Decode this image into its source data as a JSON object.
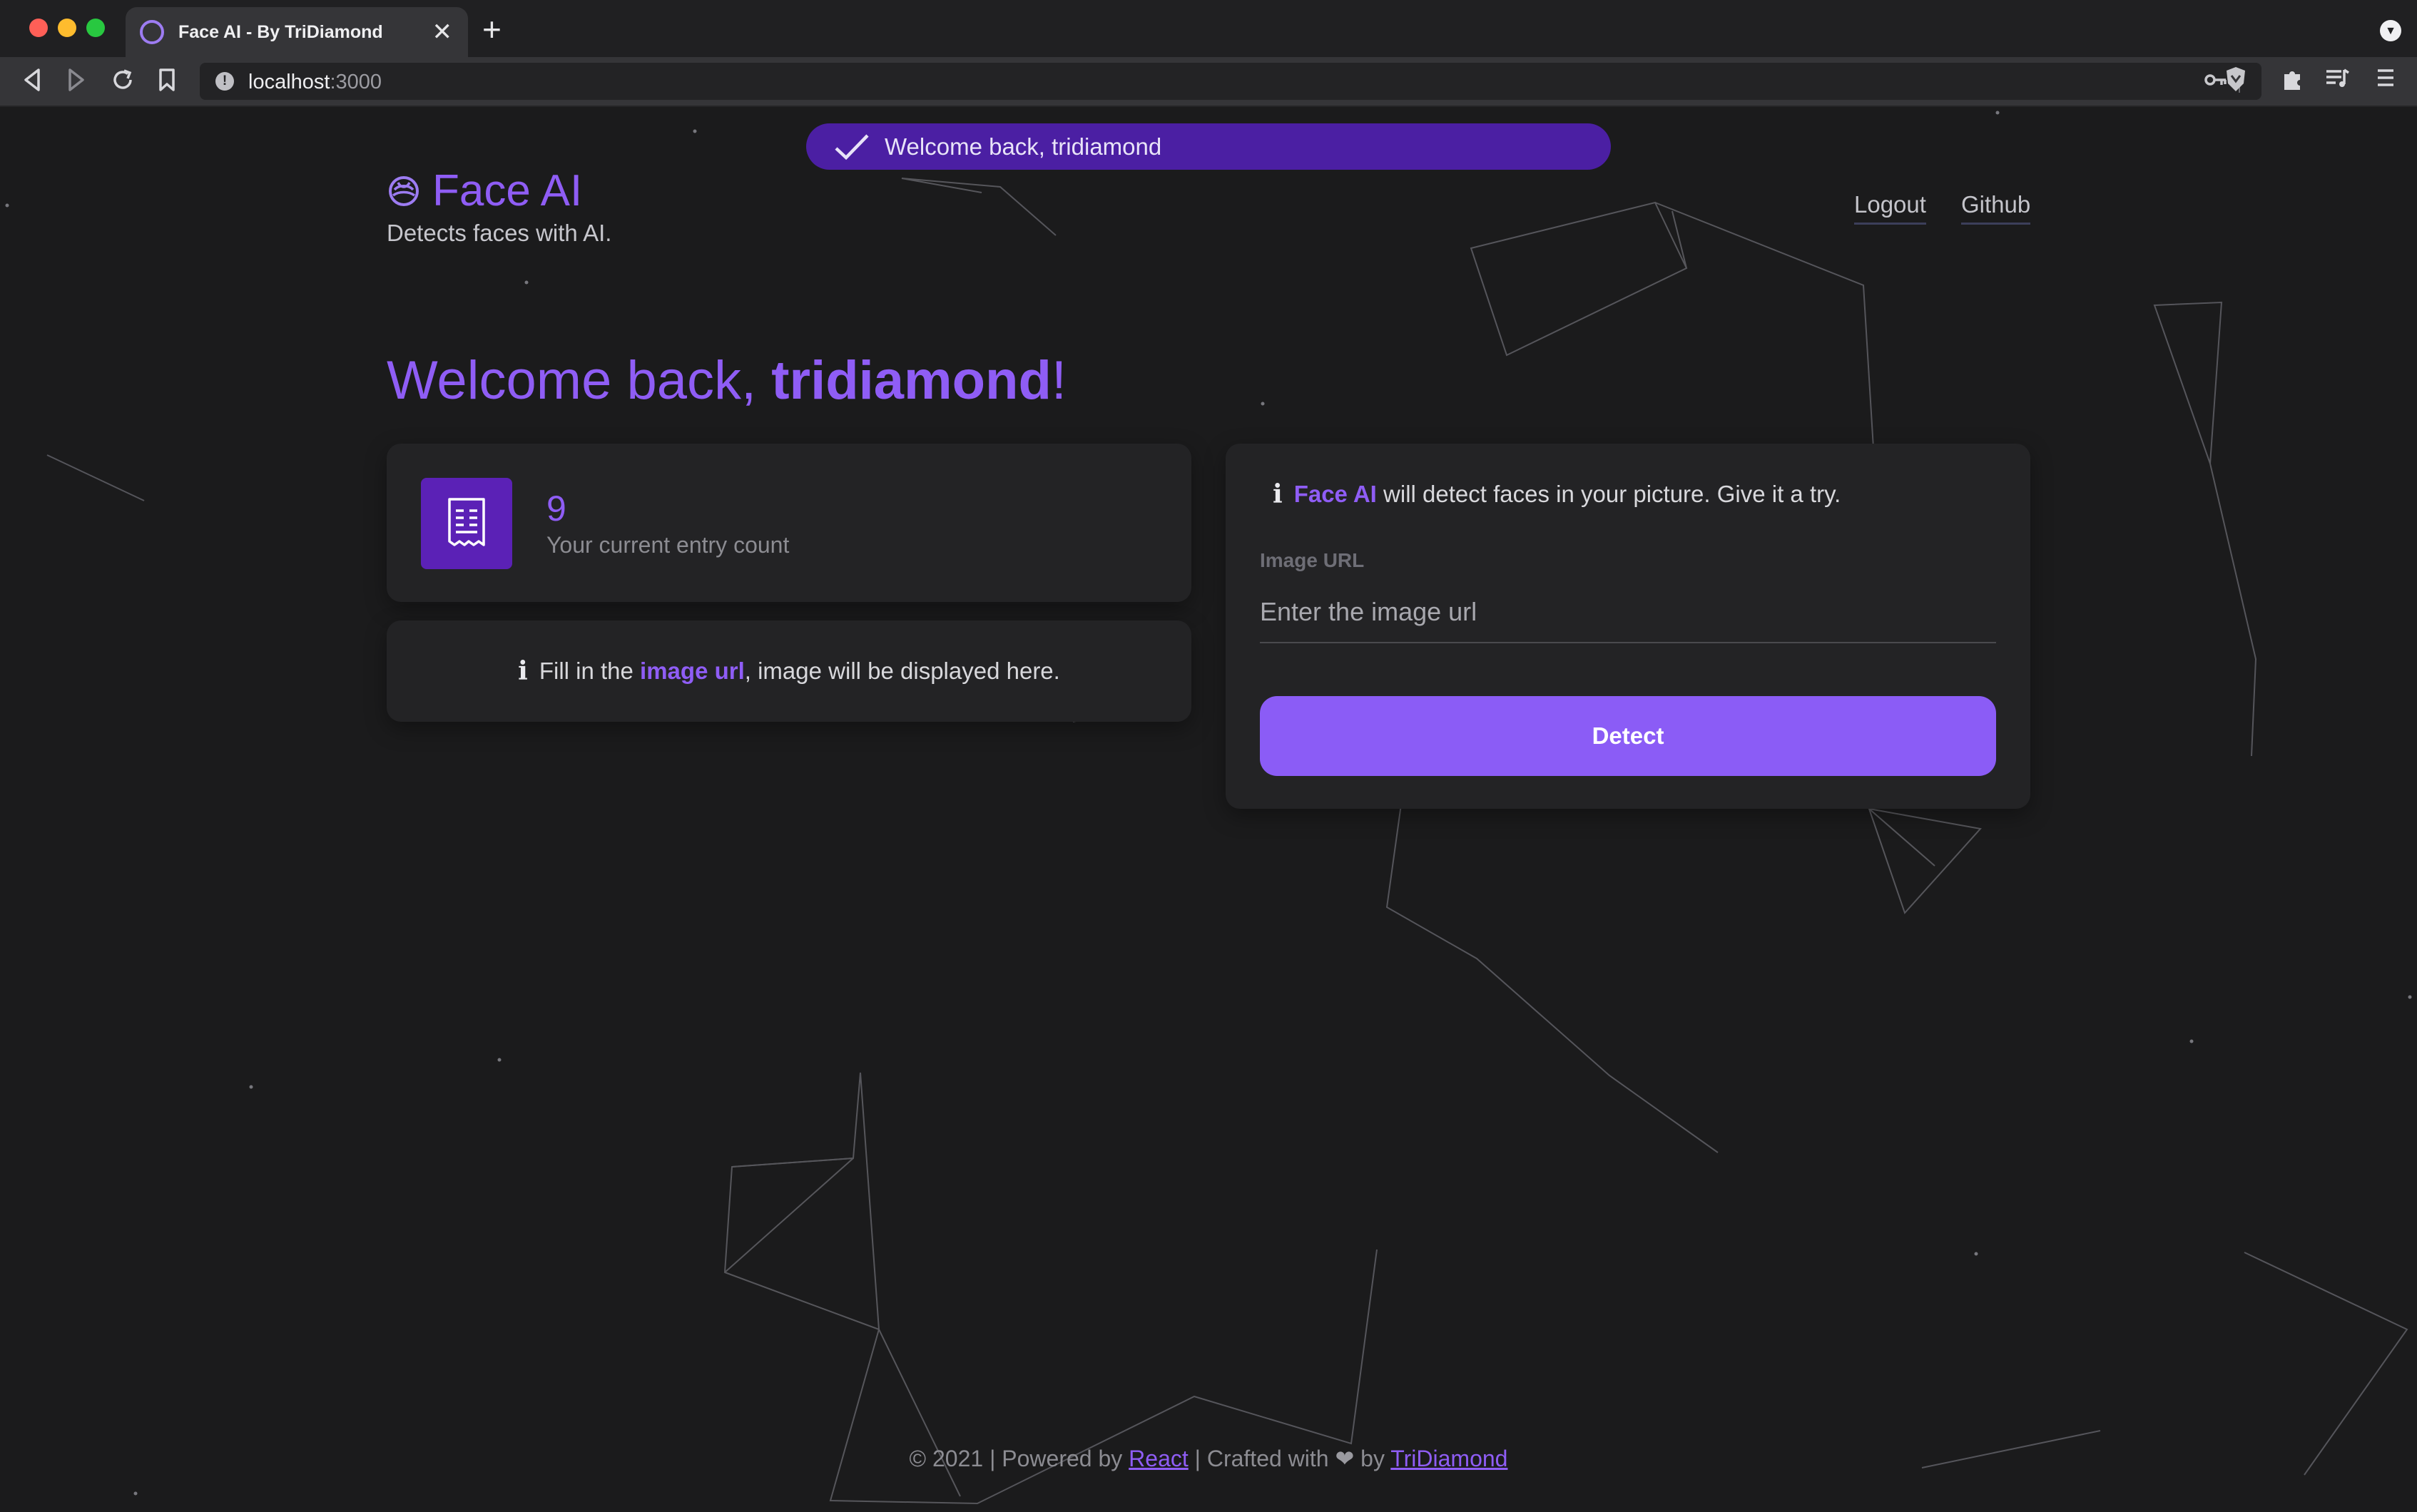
{
  "browser": {
    "tab_title": "Face AI - By TriDiamond",
    "tab_close": "✕",
    "new_tab": "+",
    "url_host": "localhost",
    "url_port": ":3000"
  },
  "toast": {
    "message": "Welcome back, tridiamond"
  },
  "header": {
    "app_name": "Face AI",
    "tagline": "Detects faces with AI.",
    "nav": {
      "logout": "Logout",
      "github": "Github"
    }
  },
  "welcome": {
    "prefix": "Welcome back, ",
    "username": "tridiamond",
    "suffix": "!"
  },
  "entry": {
    "count": "9",
    "label": "Your current entry count"
  },
  "image_panel": {
    "info_glyph": "i",
    "text_before": "Fill in the ",
    "highlight": "image url",
    "text_after": ", image will be displayed here."
  },
  "form": {
    "info_glyph": "i",
    "info_highlight": "Face AI",
    "info_text": " will detect faces in your picture. Give it a try.",
    "field_label": "Image URL",
    "input_value": "",
    "input_placeholder": "Enter the image url",
    "submit_label": "Detect"
  },
  "footer": {
    "prefix": "© 2021 | Powered by ",
    "react_link": "React",
    "middle": " | Crafted with ",
    "heart": "❤",
    "by": " by ",
    "author_link": "TriDiamond"
  },
  "colors": {
    "accent": "#8f5df5",
    "background": "#1b1b1c",
    "card": "#232325",
    "toast": "#4b1fa3",
    "button": "#8b5cf6"
  },
  "icons": [
    "back-icon",
    "forward-icon",
    "reload-icon",
    "bookmark-icon",
    "info-icon",
    "key-icon",
    "brave-shield-icon",
    "extensions-icon",
    "playlist-icon",
    "menu-icon",
    "check-icon",
    "receipt-icon"
  ]
}
